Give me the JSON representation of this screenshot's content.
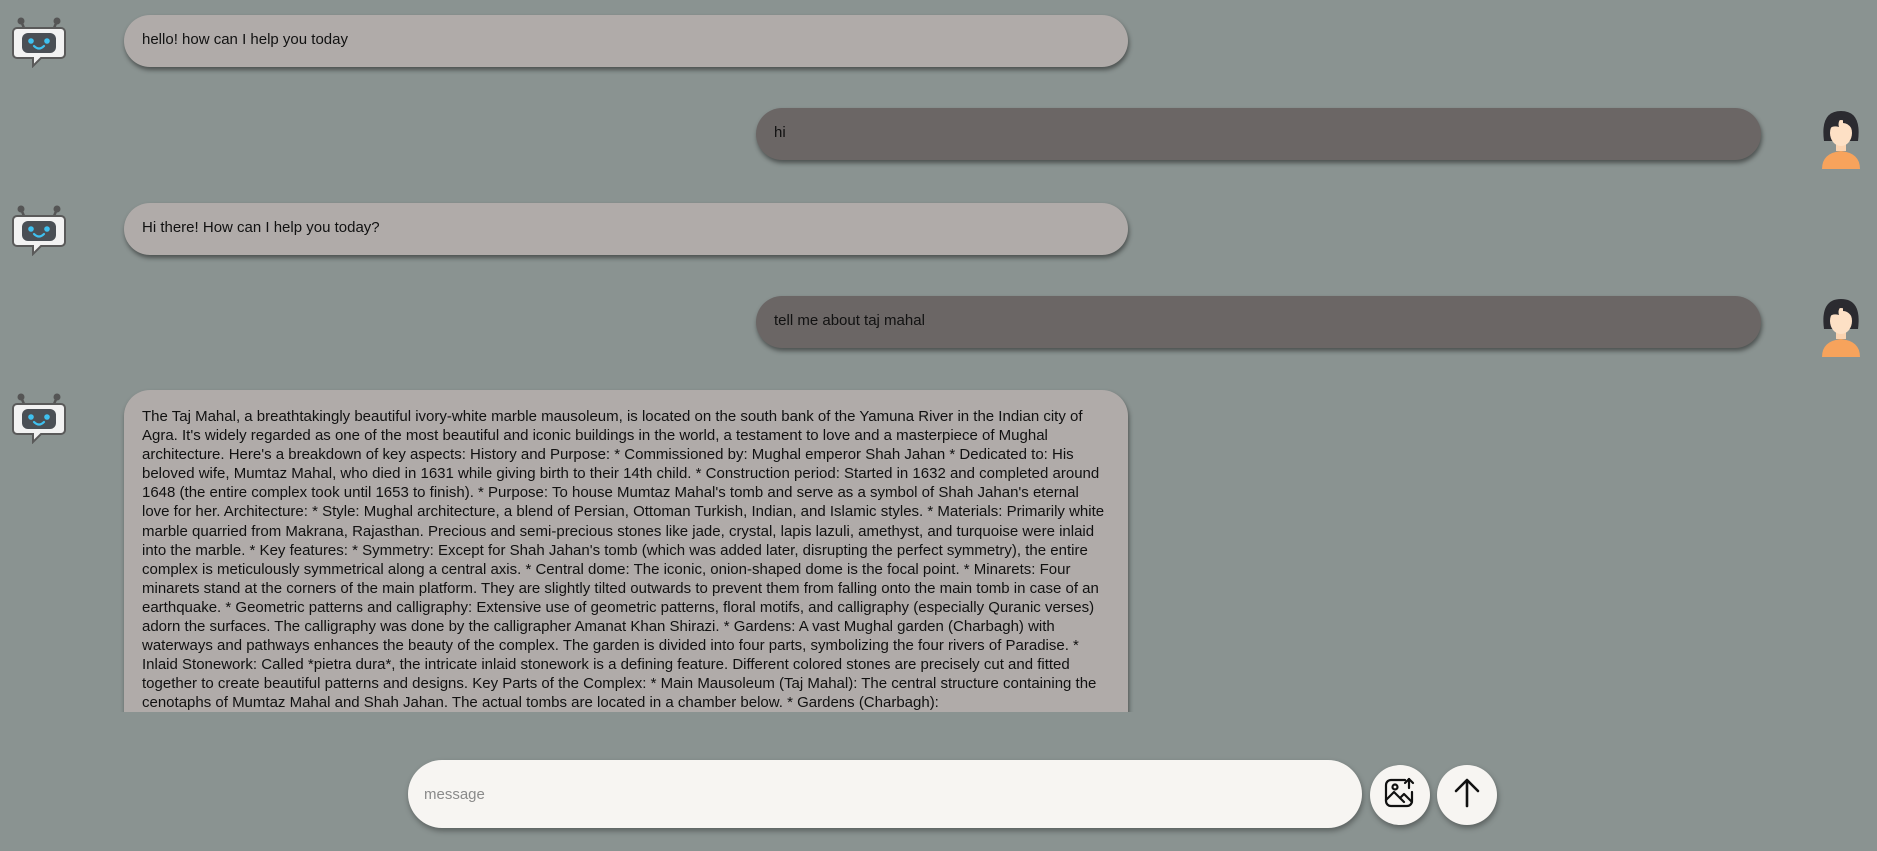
{
  "messages": [
    {
      "role": "bot",
      "text": "hello! how can I help you today"
    },
    {
      "role": "user",
      "text": "hi"
    },
    {
      "role": "bot",
      "text": "Hi there! How can I help you today?"
    },
    {
      "role": "user",
      "text": "tell me about taj mahal"
    },
    {
      "role": "bot",
      "text": "The Taj Mahal, a breathtakingly beautiful ivory-white marble mausoleum, is located on the south bank of the Yamuna River in the Indian city of Agra. It's widely regarded as one of the most beautiful and iconic buildings in the world, a testament to love and a masterpiece of Mughal architecture. Here's a breakdown of key aspects: History and Purpose: * Commissioned by: Mughal emperor Shah Jahan * Dedicated to: His beloved wife, Mumtaz Mahal, who died in 1631 while giving birth to their 14th child. * Construction period: Started in 1632 and completed around 1648 (the entire complex took until 1653 to finish). * Purpose: To house Mumtaz Mahal's tomb and serve as a symbol of Shah Jahan's eternal love for her. Architecture: * Style: Mughal architecture, a blend of Persian, Ottoman Turkish, Indian, and Islamic styles. * Materials: Primarily white marble quarried from Makrana, Rajasthan. Precious and semi-precious stones like jade, crystal, lapis lazuli, amethyst, and turquoise were inlaid into the marble. * Key features: * Symmetry: Except for Shah Jahan's tomb (which was added later, disrupting the perfect symmetry), the entire complex is meticulously symmetrical along a central axis. * Central dome: The iconic, onion-shaped dome is the focal point. * Minarets: Four minarets stand at the corners of the main platform. They are slightly tilted outwards to prevent them from falling onto the main tomb in case of an earthquake. * Geometric patterns and calligraphy: Extensive use of geometric patterns, floral motifs, and calligraphy (especially Quranic verses) adorn the surfaces. The calligraphy was done by the calligrapher Amanat Khan Shirazi. * Gardens: A vast Mughal garden (Charbagh) with waterways and pathways enhances the beauty of the complex. The garden is divided into four parts, symbolizing the four rivers of Paradise. * Inlaid Stonework: Called *pietra dura*, the intricate inlaid stonework is a defining feature. Different colored stones are precisely cut and fitted together to create beautiful patterns and designs. Key Parts of the Complex: * Main Mausoleum (Taj Mahal): The central structure containing the cenotaphs of Mumtaz Mahal and Shah Jahan. The actual tombs are located in a chamber below. * Gardens (Charbagh):"
    }
  ],
  "composer": {
    "placeholder": "message",
    "value": ""
  },
  "icons": {
    "bot_avatar": "robot-chat-icon",
    "user_avatar": "woman-user-icon",
    "upload_image": "image-upload-icon",
    "send": "arrow-up-icon"
  },
  "colors": {
    "background": "#8a9391",
    "bot_bubble": "#b0aba9",
    "user_bubble": "#6b6665",
    "composer": "#f7f5f2"
  }
}
